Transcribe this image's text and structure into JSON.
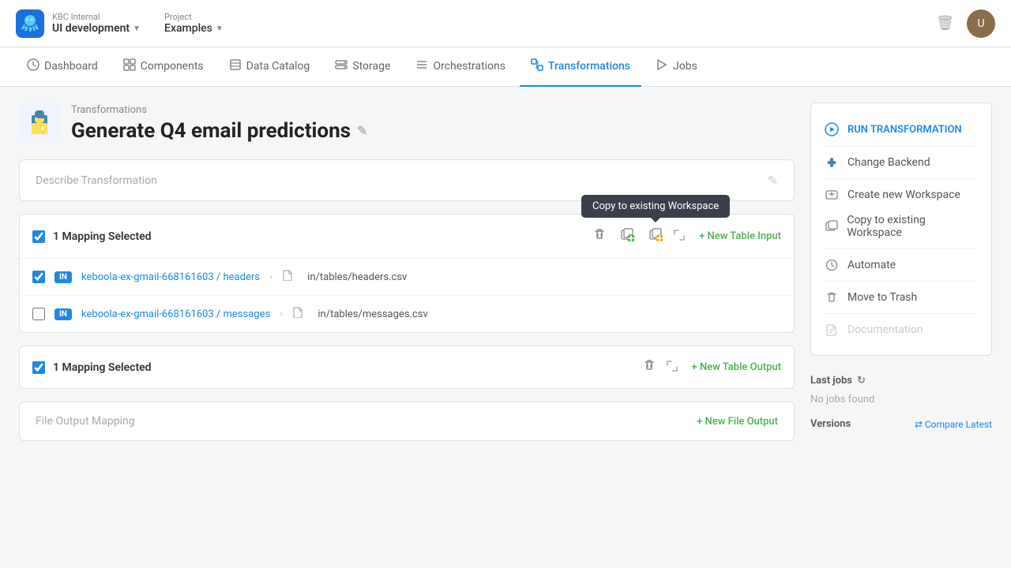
{
  "topbar": {
    "company": "KBC Internal",
    "workspace": "UI development",
    "project_label": "Project",
    "project": "Examples",
    "trash_label": "trash",
    "avatar_initials": "U"
  },
  "nav": {
    "items": [
      {
        "id": "dashboard",
        "label": "Dashboard",
        "icon": "⏱",
        "active": false
      },
      {
        "id": "components",
        "label": "Components",
        "icon": "◈",
        "active": false
      },
      {
        "id": "data-catalog",
        "label": "Data Catalog",
        "icon": "▦",
        "active": false
      },
      {
        "id": "storage",
        "label": "Storage",
        "icon": "▤",
        "active": false
      },
      {
        "id": "orchestrations",
        "label": "Orchestrations",
        "icon": "≡",
        "active": false
      },
      {
        "id": "transformations",
        "label": "Transformations",
        "icon": "⧉",
        "active": true
      },
      {
        "id": "jobs",
        "label": "Jobs",
        "icon": "▶",
        "active": false
      }
    ]
  },
  "page": {
    "breadcrumb": "Transformations",
    "title": "Generate Q4 email predictions",
    "describe_placeholder": "Describe Transformation"
  },
  "input_mapping": {
    "title": "1 Mapping Selected",
    "new_table_label": "+ New Table Input",
    "tooltip": "Copy to existing Workspace",
    "rows": [
      {
        "checked": true,
        "badge": "IN",
        "source": "keboola-ex-gmail-668161603 / headers",
        "dest": "in/tables/headers.csv"
      },
      {
        "checked": false,
        "badge": "IN",
        "source": "keboola-ex-gmail-668161603 / messages",
        "dest": "in/tables/messages.csv"
      }
    ]
  },
  "output_mapping": {
    "title": "1 Mapping Selected",
    "new_table_label": "+ New Table Output"
  },
  "file_output": {
    "label": "File Output Mapping",
    "new_file_label": "+ New File Output"
  },
  "sidebar": {
    "run_label": "RUN TRANSFORMATION",
    "actions": [
      {
        "id": "change-backend",
        "label": "Change Backend",
        "icon": "python",
        "disabled": false
      },
      {
        "id": "create-workspace",
        "label": "Create new Workspace",
        "icon": "workspace",
        "disabled": false
      },
      {
        "id": "copy-workspace",
        "label": "Copy to existing Workspace",
        "icon": "copy-workspace",
        "disabled": false
      },
      {
        "id": "automate",
        "label": "Automate",
        "icon": "clock",
        "disabled": false
      },
      {
        "id": "move-trash",
        "label": "Move to Trash",
        "icon": "trash",
        "disabled": false
      },
      {
        "id": "documentation",
        "label": "Documentation",
        "icon": "doc",
        "disabled": true
      }
    ],
    "last_jobs_title": "Last jobs",
    "no_jobs": "No jobs found",
    "versions_title": "Versions",
    "compare_label": "⇄ Compare Latest"
  }
}
